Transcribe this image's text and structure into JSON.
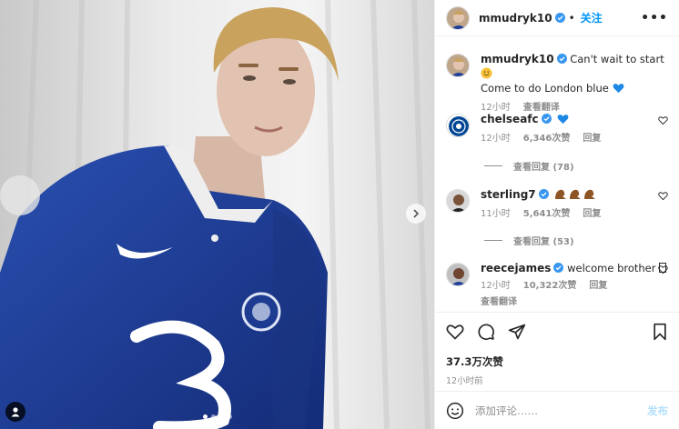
{
  "post": {
    "author": "mmudryk10",
    "follow_label": "关注",
    "more_label": "•••",
    "caption_line1": "Can't wait to start",
    "caption_line2": "Come to do London blue",
    "caption_time": "12小时",
    "caption_translate": "查看翻译"
  },
  "comments": [
    {
      "user": "chelseafc",
      "text": "",
      "time": "12小时",
      "likes": "6,346次赞",
      "reply": "回复",
      "view_replies": "查看回复 (78)"
    },
    {
      "user": "sterling7",
      "text": "",
      "time": "11小时",
      "likes": "5,641次赞",
      "reply": "回复",
      "view_replies": "查看回复 (53)"
    },
    {
      "user": "reecejames",
      "text": "welcome brother",
      "time": "12小时",
      "likes": "10,322次赞",
      "reply": "回复",
      "translate": "查看翻译"
    }
  ],
  "stats": {
    "likes": "37.3万次赞",
    "time": "12小时前"
  },
  "composer": {
    "placeholder": "添加评论……",
    "publish_label": "发布"
  },
  "colors": {
    "accent": "#0095f6",
    "verified": "#3897f0",
    "kit_blue": "#1f3f9a",
    "publish_disabled": "#b2dffc"
  },
  "carousel": {
    "total": 4,
    "active": 0
  },
  "icons": [
    "verified-icon",
    "heart-icon",
    "comment-icon",
    "share-icon",
    "bookmark-icon",
    "smile-icon",
    "chevron-right-icon",
    "user-icon"
  ]
}
